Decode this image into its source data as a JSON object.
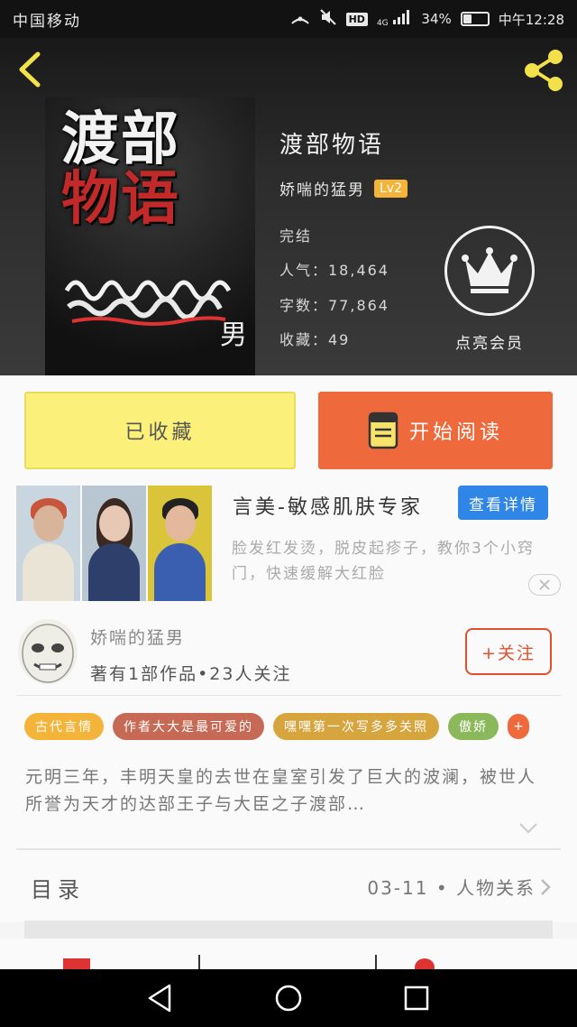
{
  "status_bar": {
    "carrier": "中国移动",
    "network": "4G",
    "hd": "HD",
    "battery": "34%",
    "battery_level": 0.34,
    "time": "中午12:28"
  },
  "book": {
    "cover_text_line1": "渡部",
    "cover_text_line2": "物语",
    "title": "渡部物语",
    "author": "娇喘的猛男",
    "level": "Lv2",
    "status": "完结",
    "popularity": "人气：18,464",
    "words": "字数：77,864",
    "favorites": "收藏：49"
  },
  "vip": {
    "label": "点亮会员",
    "icon": "crown-icon"
  },
  "actions": {
    "fav_label": "已收藏",
    "read_label": "开始阅读",
    "fav_color": "#fbf07a",
    "read_color": "#ee6a3c"
  },
  "ad": {
    "title": "言美-敏感肌肤专家",
    "detail_label": "查看详情",
    "description": "脸发红发烫，脱皮起疹子，教你3个小窍门，快速缓解大红脸",
    "close_icon": "close-icon"
  },
  "author_section": {
    "name": "娇喘的猛男",
    "stats": "著有1部作品•23人关注",
    "follow_label": "+关注"
  },
  "tags": [
    {
      "label": "古代言情",
      "color": "#f4b43a"
    },
    {
      "label": "作者大大是最可爱的",
      "color": "#c76a55"
    },
    {
      "label": "嘿嘿第一次写多多关照",
      "color": "#d7a53d"
    },
    {
      "label": "傲娇",
      "color": "#8ab85a"
    }
  ],
  "synopsis": "元明三年，丰明天皇的去世在皇室引发了巨大的波澜，被世人所誉为天才的达部王子与大臣之子渡部…",
  "catalog": {
    "label": "目录",
    "latest": "03-11 • 人物关系"
  },
  "colors": {
    "accent": "#ee6a3c",
    "follow": "#e0502e",
    "detail_button": "#2f86e6"
  }
}
